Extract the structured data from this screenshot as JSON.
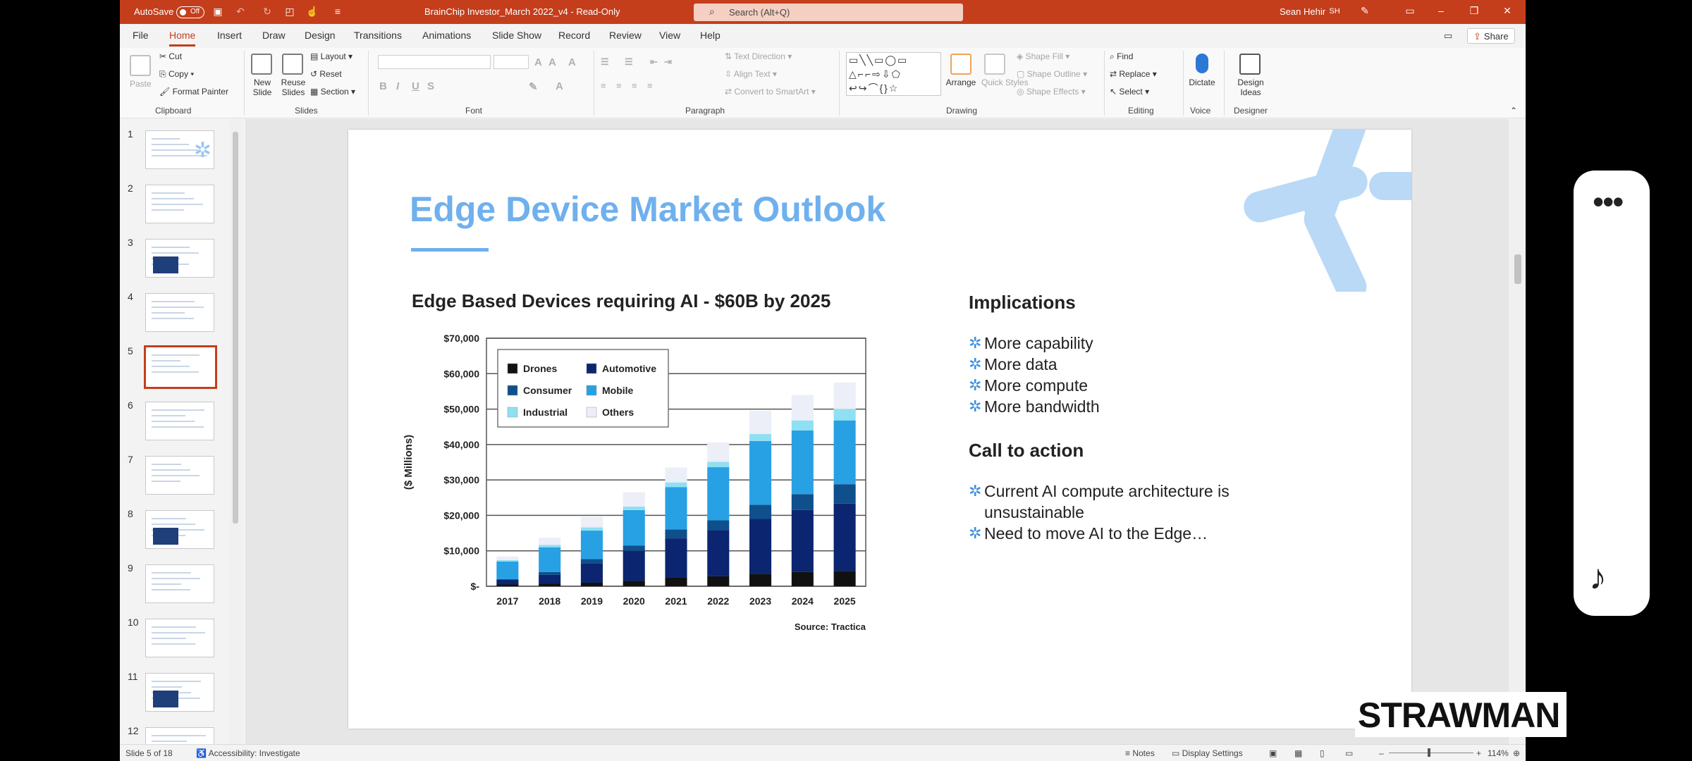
{
  "titlebar": {
    "autosave_label": "AutoSave",
    "autosave_state": "Off",
    "doc_title": "BrainChip Investor_March 2022_v4  -  Read-Only",
    "search_placeholder": "Search (Alt+Q)",
    "user_name": "Sean Hehir",
    "user_initials": "SH"
  },
  "menu": {
    "tabs": [
      "File",
      "Home",
      "Insert",
      "Draw",
      "Design",
      "Transitions",
      "Animations",
      "Slide Show",
      "Record",
      "Review",
      "View",
      "Help"
    ],
    "active_tab": "Home",
    "share_label": "Share"
  },
  "ribbon": {
    "clipboard": {
      "paste": "Paste",
      "cut": "Cut",
      "copy": "Copy",
      "format_painter": "Format Painter",
      "label": "Clipboard"
    },
    "slides": {
      "new_slide": "New Slide",
      "reuse_slides": "Reuse Slides",
      "layout": "Layout",
      "reset": "Reset",
      "section": "Section",
      "label": "Slides"
    },
    "font": {
      "label": "Font"
    },
    "paragraph": {
      "text_direction": "Text Direction",
      "align_text": "Align Text",
      "convert_smartart": "Convert to SmartArt",
      "label": "Paragraph"
    },
    "drawing": {
      "arrange": "Arrange",
      "quick_styles": "Quick Styles",
      "shape_fill": "Shape Fill",
      "shape_outline": "Shape Outline",
      "shape_effects": "Shape Effects",
      "label": "Drawing"
    },
    "editing": {
      "find": "Find",
      "replace": "Replace",
      "select": "Select",
      "label": "Editing"
    },
    "voice": {
      "dictate": "Dictate",
      "label": "Voice"
    },
    "designer": {
      "design_ideas": "Design Ideas",
      "label": "Designer"
    }
  },
  "thumbnails": [
    "1",
    "2",
    "3",
    "4",
    "5",
    "6",
    "7",
    "8",
    "9",
    "10",
    "11",
    "12"
  ],
  "selected_slide": 5,
  "slide": {
    "title": "Edge Device Market Outlook",
    "chart_title": "Edge Based Devices requiring AI - $60B by 2025",
    "implications_heading": "Implications",
    "implications": [
      "More capability",
      "More data",
      "More compute",
      "More bandwidth"
    ],
    "cta_heading": "Call to action",
    "cta": [
      "Current AI compute architecture is unsustainable",
      "Need to move AI to the Edge…"
    ]
  },
  "chart_data": {
    "type": "bar",
    "stacked": true,
    "categories": [
      "2017",
      "2018",
      "2019",
      "2020",
      "2021",
      "2022",
      "2023",
      "2024",
      "2025"
    ],
    "ylabel": "($ Millions)",
    "ylim": [
      0,
      70000
    ],
    "yticks": [
      "$-",
      "$10,000",
      "$20,000",
      "$30,000",
      "$40,000",
      "$50,000",
      "$60,000",
      "$70,000"
    ],
    "legend_placement": "top-left",
    "source": "Source: Tractica",
    "series": [
      {
        "name": "Drones",
        "color": "#111111",
        "values": [
          500,
          700,
          1000,
          1500,
          2500,
          2800,
          3500,
          4000,
          4300
        ]
      },
      {
        "name": "Automotive",
        "color": "#0b2570",
        "values": [
          1300,
          2500,
          5500,
          8500,
          11000,
          13000,
          15500,
          17500,
          19000
        ]
      },
      {
        "name": "Consumer",
        "color": "#0e4f8c",
        "values": [
          200,
          800,
          1200,
          1500,
          2500,
          2800,
          4000,
          4500,
          5500
        ]
      },
      {
        "name": "Mobile",
        "color": "#28a0e4",
        "values": [
          5000,
          7000,
          8000,
          10000,
          12000,
          15000,
          18000,
          18000,
          18000
        ]
      },
      {
        "name": "Industrial",
        "color": "#8fe0f2",
        "values": [
          400,
          700,
          900,
          1000,
          1300,
          1500,
          2000,
          2800,
          3200
        ]
      },
      {
        "name": "Others",
        "color": "#eceef8",
        "values": [
          1000,
          2000,
          3000,
          4000,
          4200,
          5500,
          6500,
          7200,
          7500
        ]
      }
    ]
  },
  "statusbar": {
    "slide_of": "Slide 5 of 18",
    "accessibility": "Accessibility: Investigate",
    "notes": "Notes",
    "display_settings": "Display Settings",
    "zoom": "114%"
  },
  "overlay": {
    "watermark": "STRAWMAN"
  }
}
